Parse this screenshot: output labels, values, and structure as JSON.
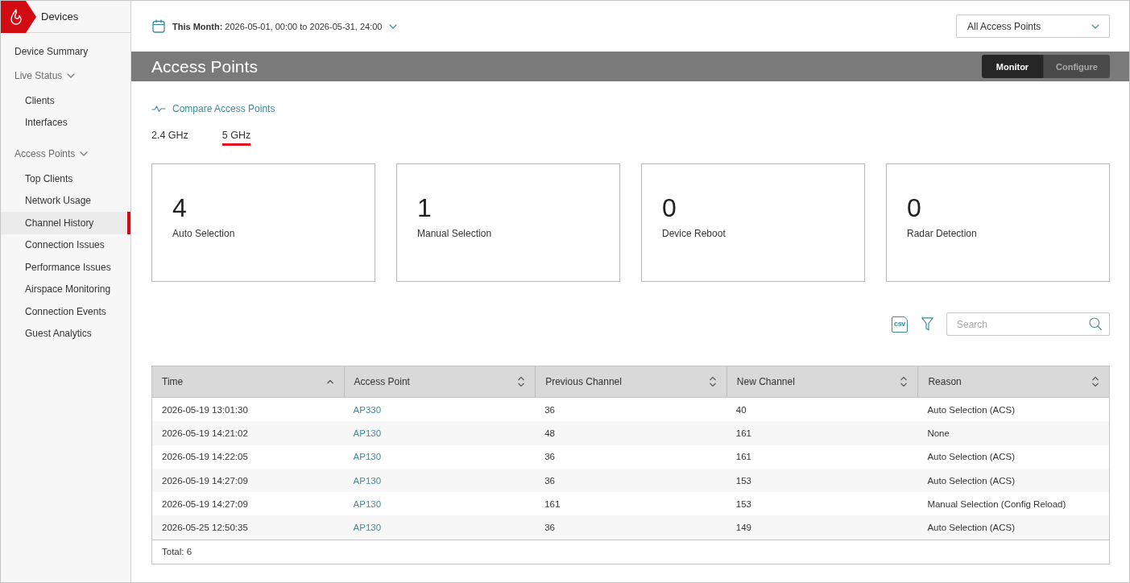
{
  "sidebar": {
    "title": "Devices",
    "items": [
      {
        "label": "Device Summary",
        "kind": "link",
        "selected": false
      },
      {
        "label": "Live Status",
        "kind": "group",
        "selected": false,
        "expanded": true,
        "children": [
          {
            "label": "Clients",
            "selected": false
          },
          {
            "label": "Interfaces",
            "selected": false
          }
        ]
      },
      {
        "label": "Access Points",
        "kind": "group",
        "selected": false,
        "expanded": true,
        "children": [
          {
            "label": "Top Clients",
            "selected": false
          },
          {
            "label": "Network Usage",
            "selected": false
          },
          {
            "label": "Channel History",
            "selected": true
          },
          {
            "label": "Connection Issues",
            "selected": false
          },
          {
            "label": "Performance Issues",
            "selected": false
          },
          {
            "label": "Airspace Monitoring",
            "selected": false
          },
          {
            "label": "Connection Events",
            "selected": false
          },
          {
            "label": "Guest Analytics",
            "selected": false
          }
        ]
      }
    ]
  },
  "date_range": {
    "label": "This Month:",
    "value": "2026-05-01, 00:00 to 2026-05-31, 24:00"
  },
  "access_point_filter": {
    "value": "All Access Points"
  },
  "page_header": {
    "title": "Access Points",
    "modes": [
      {
        "label": "Monitor",
        "selected": true
      },
      {
        "label": "Configure",
        "selected": false
      }
    ]
  },
  "compare_link": "Compare Access Points",
  "band_tabs": [
    {
      "label": "2.4 GHz",
      "selected": false
    },
    {
      "label": "5 GHz",
      "selected": true
    }
  ],
  "stat_cards": [
    {
      "value": "4",
      "label": "Auto Selection"
    },
    {
      "value": "1",
      "label": "Manual Selection"
    },
    {
      "value": "0",
      "label": "Device Reboot"
    },
    {
      "value": "0",
      "label": "Radar Detection"
    }
  ],
  "table_tools": {
    "export_label": "csv",
    "search": {
      "placeholder": "Search"
    }
  },
  "table": {
    "columns": [
      {
        "label": "Time",
        "kind": "text",
        "sorted": true,
        "descending": false
      },
      {
        "label": "Access Point",
        "kind": "link",
        "sorted": false
      },
      {
        "label": "Previous Channel",
        "kind": "text",
        "sorted": false
      },
      {
        "label": "New Channel",
        "kind": "text",
        "sorted": false
      },
      {
        "label": "Reason",
        "kind": "text",
        "sorted": false
      }
    ],
    "rows": [
      [
        "2026-05-19 13:01:30",
        "AP330",
        "36",
        "40",
        "Auto Selection (ACS)"
      ],
      [
        "2026-05-19 14:21:02",
        "AP130",
        "48",
        "161",
        "None"
      ],
      [
        "2026-05-19 14:22:05",
        "AP130",
        "36",
        "161",
        "Auto Selection (ACS)"
      ],
      [
        "2026-05-19 14:27:09",
        "AP130",
        "36",
        "153",
        "Auto Selection (ACS)"
      ],
      [
        "2026-05-19 14:27:09",
        "AP130",
        "161",
        "153",
        "Manual Selection (Config Reload)"
      ],
      [
        "2026-05-25 12:50:35",
        "AP130",
        "36",
        "149",
        "Auto Selection (ACS)"
      ]
    ],
    "footer": "Total: 6"
  }
}
